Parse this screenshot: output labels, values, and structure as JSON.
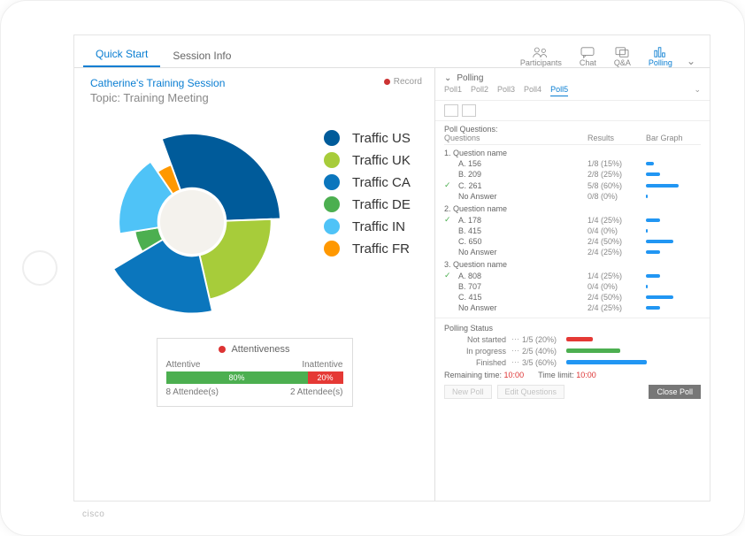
{
  "tabs": {
    "left": [
      "Quick Start",
      "Session Info"
    ]
  },
  "tools": [
    {
      "id": "participants",
      "label": "Participants"
    },
    {
      "id": "chat",
      "label": "Chat"
    },
    {
      "id": "qa",
      "label": "Q&A"
    },
    {
      "id": "polling",
      "label": "Polling"
    }
  ],
  "session": {
    "title": "Catherine's Training Session",
    "topic": "Topic:  Training Meeting",
    "record": "Record"
  },
  "chart_data": {
    "type": "pie",
    "title": "",
    "series": [
      {
        "name": "Traffic US",
        "value": 30,
        "color": "#005b9a"
      },
      {
        "name": "Traffic UK",
        "value": 22,
        "color": "#a7cc3a"
      },
      {
        "name": "Traffic CA",
        "value": 20,
        "color": "#0b76bd"
      },
      {
        "name": "Traffic DE",
        "value": 6,
        "color": "#4caf50"
      },
      {
        "name": "Traffic IN",
        "value": 18,
        "color": "#4fc3f7"
      },
      {
        "name": "Traffic FR",
        "value": 4,
        "color": "#ff9800"
      }
    ],
    "inner_hole": 0.36,
    "note": "values are estimated shares; chart is a multi-ring donut with varying outer radii"
  },
  "attent": {
    "title": "Attentiveness",
    "labels": {
      "a": "Attentive",
      "i": "Inattentive"
    },
    "values": {
      "a_pct": "80%",
      "i_pct": "20%",
      "a_n": "8 Attendee(s)",
      "i_n": "2 Attendee(s)"
    },
    "a_w": 80,
    "i_w": 20
  },
  "polling": {
    "header": "Polling",
    "tabs": [
      "Poll1",
      "Poll2",
      "Poll3",
      "Poll4",
      "Poll5"
    ],
    "activeTab": 4,
    "section": "Poll Questions:",
    "cols": {
      "q": "Questions",
      "r": "Results",
      "b": "Bar Graph"
    },
    "questions": [
      {
        "title": "1.  Question name",
        "answers": [
          {
            "chk": false,
            "lbl": "A. 156",
            "res": "1/8 (15%)",
            "pct": 15
          },
          {
            "chk": false,
            "lbl": "B. 209",
            "res": "2/8 (25%)",
            "pct": 25
          },
          {
            "chk": true,
            "lbl": "C. 261",
            "res": "5/8 (60%)",
            "pct": 60
          },
          {
            "chk": false,
            "lbl": "No Answer",
            "res": "0/8 (0%)",
            "pct": 0
          }
        ]
      },
      {
        "title": "2.  Question name",
        "answers": [
          {
            "chk": true,
            "lbl": "A. 178",
            "res": "1/4 (25%)",
            "pct": 25
          },
          {
            "chk": false,
            "lbl": "B. 415",
            "res": "0/4 (0%)",
            "pct": 0
          },
          {
            "chk": false,
            "lbl": "C. 650",
            "res": "2/4 (50%)",
            "pct": 50
          },
          {
            "chk": false,
            "lbl": "No Answer",
            "res": "2/4 (25%)",
            "pct": 25
          }
        ]
      },
      {
        "title": "3.  Question name",
        "answers": [
          {
            "chk": true,
            "lbl": "A. 808",
            "res": "1/4 (25%)",
            "pct": 25
          },
          {
            "chk": false,
            "lbl": "B. 707",
            "res": "0/4 (0%)",
            "pct": 0
          },
          {
            "chk": false,
            "lbl": "C. 415",
            "res": "2/4 (50%)",
            "pct": 50
          },
          {
            "chk": false,
            "lbl": "No Answer",
            "res": "2/4 (25%)",
            "pct": 25
          }
        ]
      }
    ],
    "status": {
      "title": "Polling Status",
      "rows": [
        {
          "label": "Not started",
          "val": "1/5 (20%)",
          "pct": 20,
          "color": "#e53935"
        },
        {
          "label": "In progress",
          "val": "2/5 (40%)",
          "pct": 40,
          "color": "#4caf50"
        },
        {
          "label": "Finished",
          "val": "3/5 (60%)",
          "pct": 60,
          "color": "#2196f3"
        }
      ],
      "remaining_lbl": "Remaining time:",
      "remaining_val": "10:00",
      "limit_lbl": "Time limit:",
      "limit_val": "10:00"
    },
    "buttons": {
      "new": "New Poll",
      "edit": "Edit Questions",
      "close": "Close Poll"
    }
  },
  "brand": "cisco"
}
